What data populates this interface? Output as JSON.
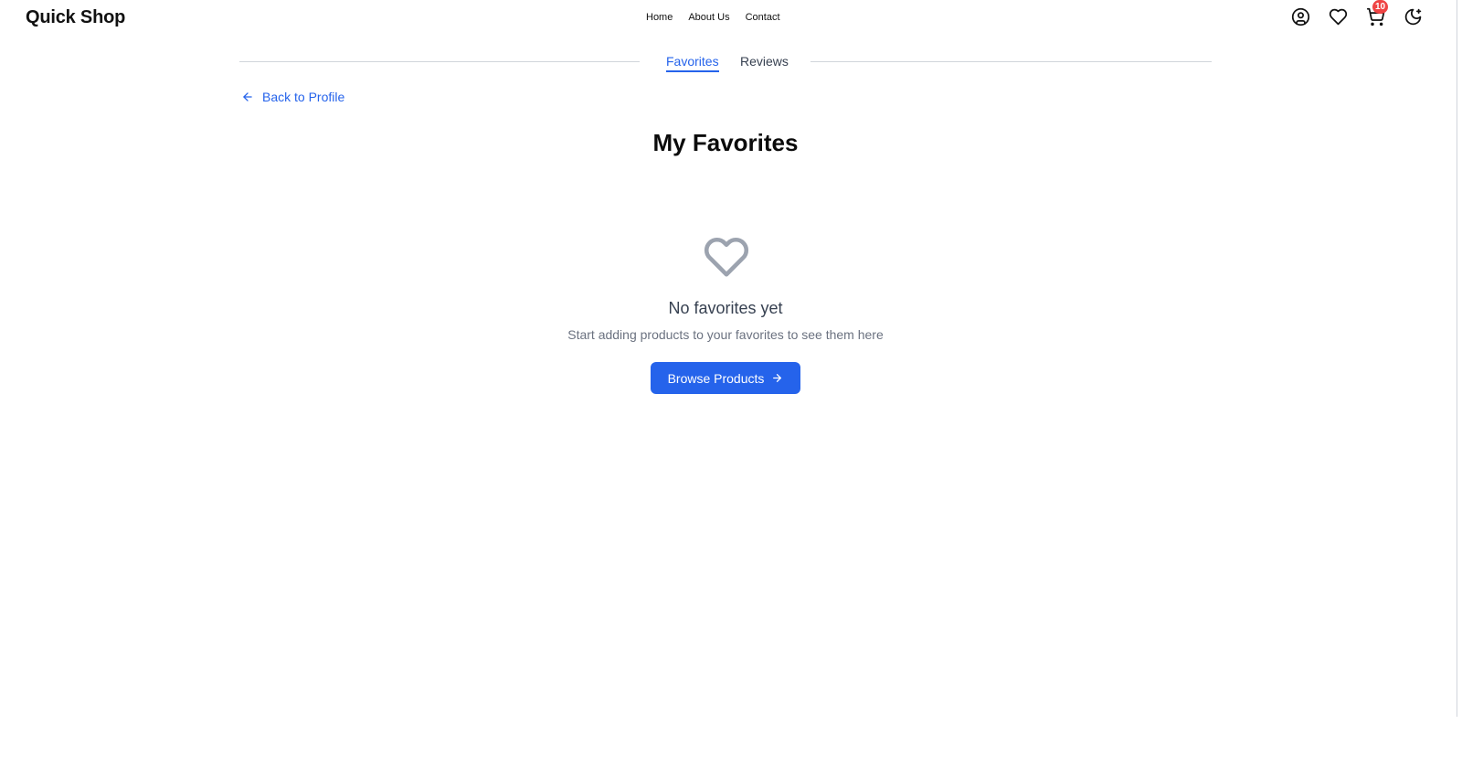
{
  "header": {
    "logo": "Quick Shop",
    "nav": {
      "home": "Home",
      "about": "About Us",
      "contact": "Contact"
    },
    "icons": [
      "user-circle-icon",
      "heart-icon",
      "cart-icon",
      "moon-icon"
    ],
    "cart_count": "10"
  },
  "tabs": {
    "favorites": "Favorites",
    "reviews": "Reviews",
    "active": "Favorites"
  },
  "back_link": {
    "label": "Back to Profile",
    "icon": "arrow-left-icon"
  },
  "page": {
    "title": "My Favorites"
  },
  "empty_state": {
    "icon": "heart-outline-icon",
    "title": "No favorites yet",
    "subtitle": "Start adding products to your favorites to see them here",
    "button_label": "Browse Products",
    "button_icon": "arrow-right-icon"
  },
  "colors": {
    "accent": "#2563eb",
    "link": "#2563eb",
    "badge": "#ef4444",
    "empty_icon": "#9ca3af",
    "divider": "#d1d5db"
  }
}
